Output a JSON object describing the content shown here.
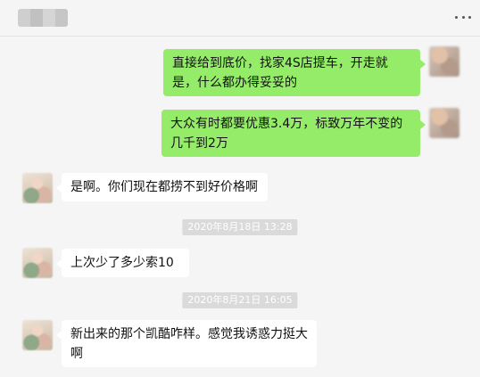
{
  "header": {
    "more_icon": "more-horizontal-icon"
  },
  "colors": {
    "sent_bubble": "#95ec69",
    "received_bubble": "#ffffff",
    "background": "#f5f5f5",
    "timestamp_bg": "#dadada"
  },
  "messages": [
    {
      "direction": "sent",
      "text": "直接给到底价，找家4S店提车，开走就是，什么都办得妥妥的"
    },
    {
      "direction": "sent",
      "text": "大众有时都要优惠3.4万，标致万年不变的几千到2万"
    },
    {
      "direction": "received",
      "text": "是啊。你们现在都捞不到好价格啊"
    },
    {
      "type": "timestamp",
      "text": "2020年8月18日 13:28"
    },
    {
      "direction": "received",
      "text": "上次少了多少索10"
    },
    {
      "type": "timestamp",
      "text": "2020年8月21日 16:05"
    },
    {
      "direction": "received",
      "text": "新出来的那个凯酷咋样。感觉我诱惑力挺大啊"
    }
  ]
}
